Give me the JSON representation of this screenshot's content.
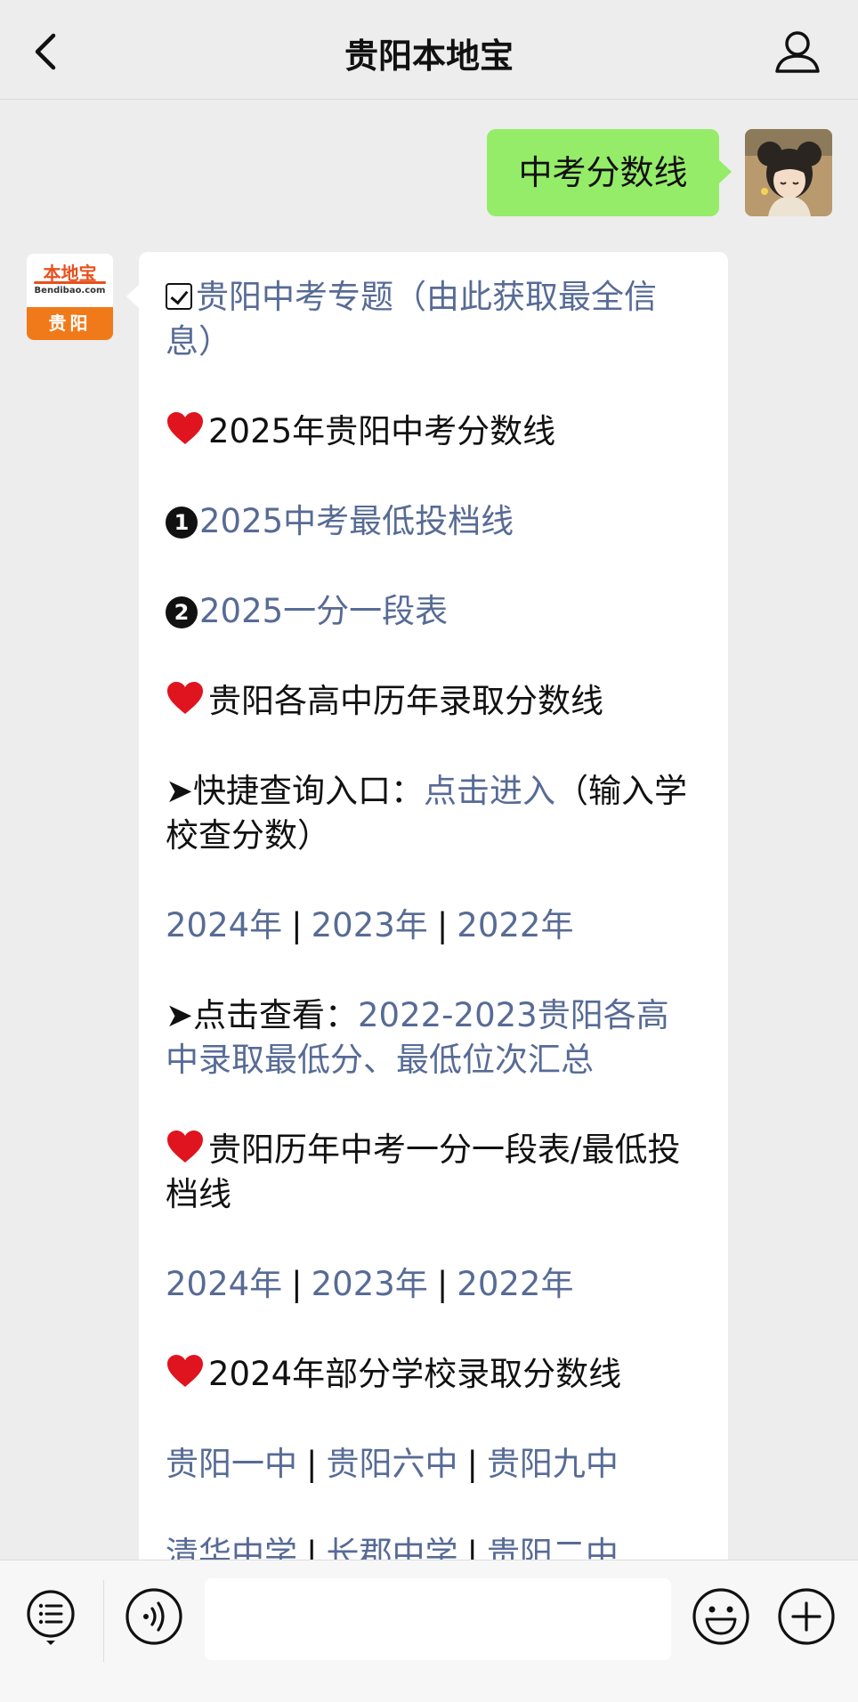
{
  "header": {
    "title": "贵阳本地宝"
  },
  "user_message": {
    "text": "中考分数线"
  },
  "bot_avatar": {
    "logo_text": "本地宝",
    "logo_domain": "Bendibao.com",
    "city": "贵阳"
  },
  "bot_message": {
    "topic_link": "贵阳中考专题（由此获取最全信息）",
    "section1_title": "2025年贵阳中考分数线",
    "item1_num": "1",
    "item1_link": "2025中考最低投档线",
    "item2_num": "2",
    "item2_link": "2025一分一段表",
    "section2_title": "贵阳各高中历年录取分数线",
    "quick_prefix": "➤快捷查询入口：",
    "quick_link": "点击进入",
    "quick_suffix": "（输入学校查分数）",
    "years_a": [
      "2024年",
      "2023年",
      "2022年"
    ],
    "view_prefix": "➤点击查看：",
    "view_link": "2022-2023贵阳各高中录取最低分、最低位次汇总",
    "section3_title": "贵阳历年中考一分一段表/最低投档线",
    "years_b": [
      "2024年",
      "2023年",
      "2022年"
    ],
    "section4_title": "2024年部分学校录取分数线",
    "schools_row1": [
      "贵阳一中",
      "贵阳六中",
      "贵阳九中"
    ],
    "schools_row2": [
      "清华中学",
      "长郡中学",
      "贵阳二中"
    ],
    "separator": "|"
  },
  "colors": {
    "link": "#576b95",
    "user_bubble": "#95ec69",
    "heart": "#e0141e"
  },
  "input": {
    "placeholder": ""
  }
}
